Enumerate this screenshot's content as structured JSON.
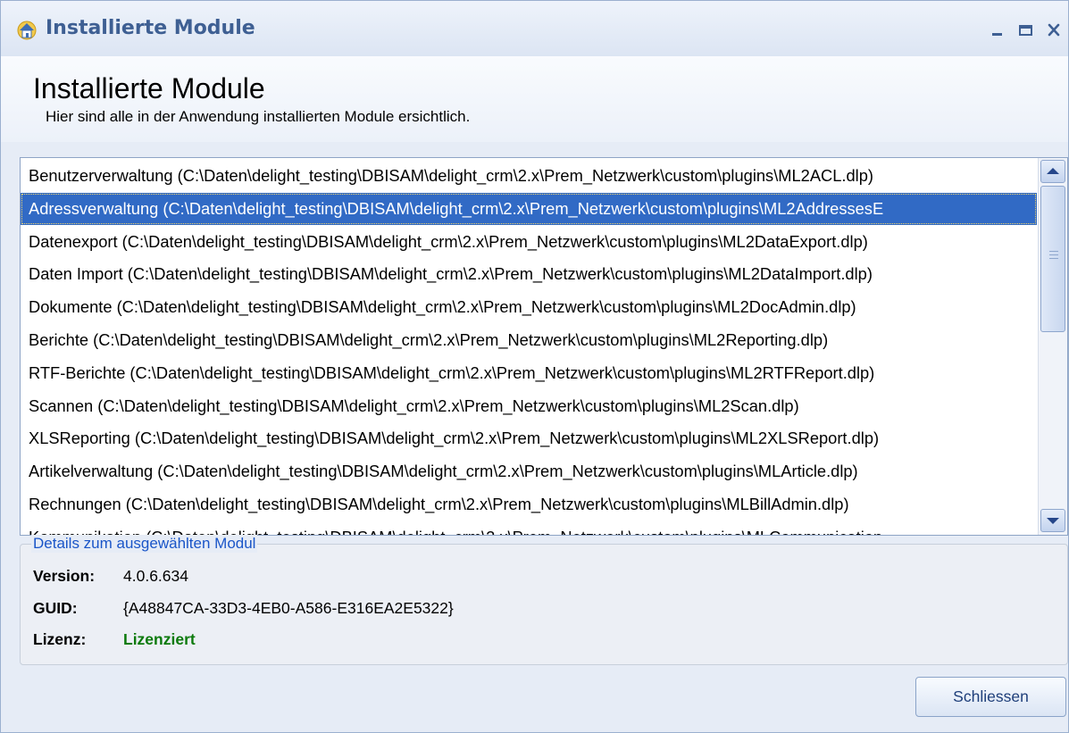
{
  "window": {
    "title": "Installierte Module",
    "icon": "house-icon",
    "controls": {
      "minimize": "minimize-icon",
      "maximize": "maximize-icon",
      "close": "close-icon"
    }
  },
  "header": {
    "title": "Installierte Module",
    "subtitle": "Hier sind alle in der Anwendung installierten Module ersichtlich."
  },
  "modules": {
    "selected_index": 1,
    "items": [
      "Benutzerverwaltung (C:\\Daten\\delight_testing\\DBISAM\\delight_crm\\2.x\\Prem_Netzwerk\\custom\\plugins\\ML2ACL.dlp)",
      "Adressverwaltung (C:\\Daten\\delight_testing\\DBISAM\\delight_crm\\2.x\\Prem_Netzwerk\\custom\\plugins\\ML2AddressesE",
      "Datenexport (C:\\Daten\\delight_testing\\DBISAM\\delight_crm\\2.x\\Prem_Netzwerk\\custom\\plugins\\ML2DataExport.dlp)",
      "Daten Import (C:\\Daten\\delight_testing\\DBISAM\\delight_crm\\2.x\\Prem_Netzwerk\\custom\\plugins\\ML2DataImport.dlp)",
      "Dokumente (C:\\Daten\\delight_testing\\DBISAM\\delight_crm\\2.x\\Prem_Netzwerk\\custom\\plugins\\ML2DocAdmin.dlp)",
      "Berichte (C:\\Daten\\delight_testing\\DBISAM\\delight_crm\\2.x\\Prem_Netzwerk\\custom\\plugins\\ML2Reporting.dlp)",
      "RTF-Berichte (C:\\Daten\\delight_testing\\DBISAM\\delight_crm\\2.x\\Prem_Netzwerk\\custom\\plugins\\ML2RTFReport.dlp)",
      "Scannen (C:\\Daten\\delight_testing\\DBISAM\\delight_crm\\2.x\\Prem_Netzwerk\\custom\\plugins\\ML2Scan.dlp)",
      "XLSReporting (C:\\Daten\\delight_testing\\DBISAM\\delight_crm\\2.x\\Prem_Netzwerk\\custom\\plugins\\ML2XLSReport.dlp)",
      "Artikelverwaltung (C:\\Daten\\delight_testing\\DBISAM\\delight_crm\\2.x\\Prem_Netzwerk\\custom\\plugins\\MLArticle.dlp)",
      "Rechnungen (C:\\Daten\\delight_testing\\DBISAM\\delight_crm\\2.x\\Prem_Netzwerk\\custom\\plugins\\MLBillAdmin.dlp)",
      "Kommunikation (C:\\Daten\\delight_testing\\DBISAM\\delight_crm\\2.x\\Prem_Netzwerk\\custom\\plugins\\MLCommunication"
    ]
  },
  "details": {
    "label": "Details zum ausgewählten Modul",
    "version_key": "Version:",
    "version_value": "4.0.6.634",
    "guid_key": "GUID:",
    "guid_value": "{A48847CA-33D3-4EB0-A586-E316EA2E5322}",
    "license_key": "Lizenz:",
    "license_value": "Lizenziert",
    "license_color": "#0c7a0c"
  },
  "footer": {
    "close_label": "Schliessen"
  },
  "colors": {
    "selection": "#316ac5",
    "accent": "#3e5f93",
    "group_label": "#1a55c8"
  }
}
